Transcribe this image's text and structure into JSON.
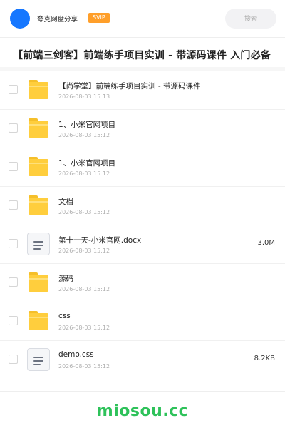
{
  "header": {
    "site_name": "夸克网盘分享",
    "badge": "SVIP",
    "search_label": "搜索",
    "avatar_color": "#1677ff",
    "badge_color": "#ff9f2a"
  },
  "title": "【前端三剑客】前端练手项目实训 - 带源码课件 入门必备",
  "title_shadow": "…",
  "files": [
    {
      "type": "folder",
      "icon": "folder-icon",
      "name": "【尚学堂】前端练手项目实训 - 带源码课件",
      "date": "2026-08-03 15:13",
      "size": ""
    },
    {
      "type": "folder",
      "icon": "folder-icon",
      "name": "1、小米官网项目",
      "date": "2026-08-03 15:12",
      "size": ""
    },
    {
      "type": "folder",
      "icon": "folder-icon",
      "name": "1、小米官网项目",
      "date": "2026-08-03 15:12",
      "size": ""
    },
    {
      "type": "folder",
      "icon": "folder-icon",
      "name": "文档",
      "date": "2026-08-03 15:12",
      "size": ""
    },
    {
      "type": "file",
      "icon": "document-icon",
      "name": "第十一天-小米官网.docx",
      "date": "2026-08-03 15:12",
      "size": "3.0M"
    },
    {
      "type": "folder",
      "icon": "folder-icon",
      "name": "源码",
      "date": "2026-08-03 15:12",
      "size": ""
    },
    {
      "type": "folder",
      "icon": "folder-icon",
      "name": "css",
      "date": "2026-08-03 15:12",
      "size": ""
    },
    {
      "type": "file",
      "icon": "document-icon",
      "name": "demo.css",
      "date": "2026-08-03 15:12",
      "size": "8.2KB"
    }
  ],
  "watermark": "miosou.cc",
  "colors": {
    "folder": "#ffce3d",
    "watermark": "#2ec25a"
  }
}
